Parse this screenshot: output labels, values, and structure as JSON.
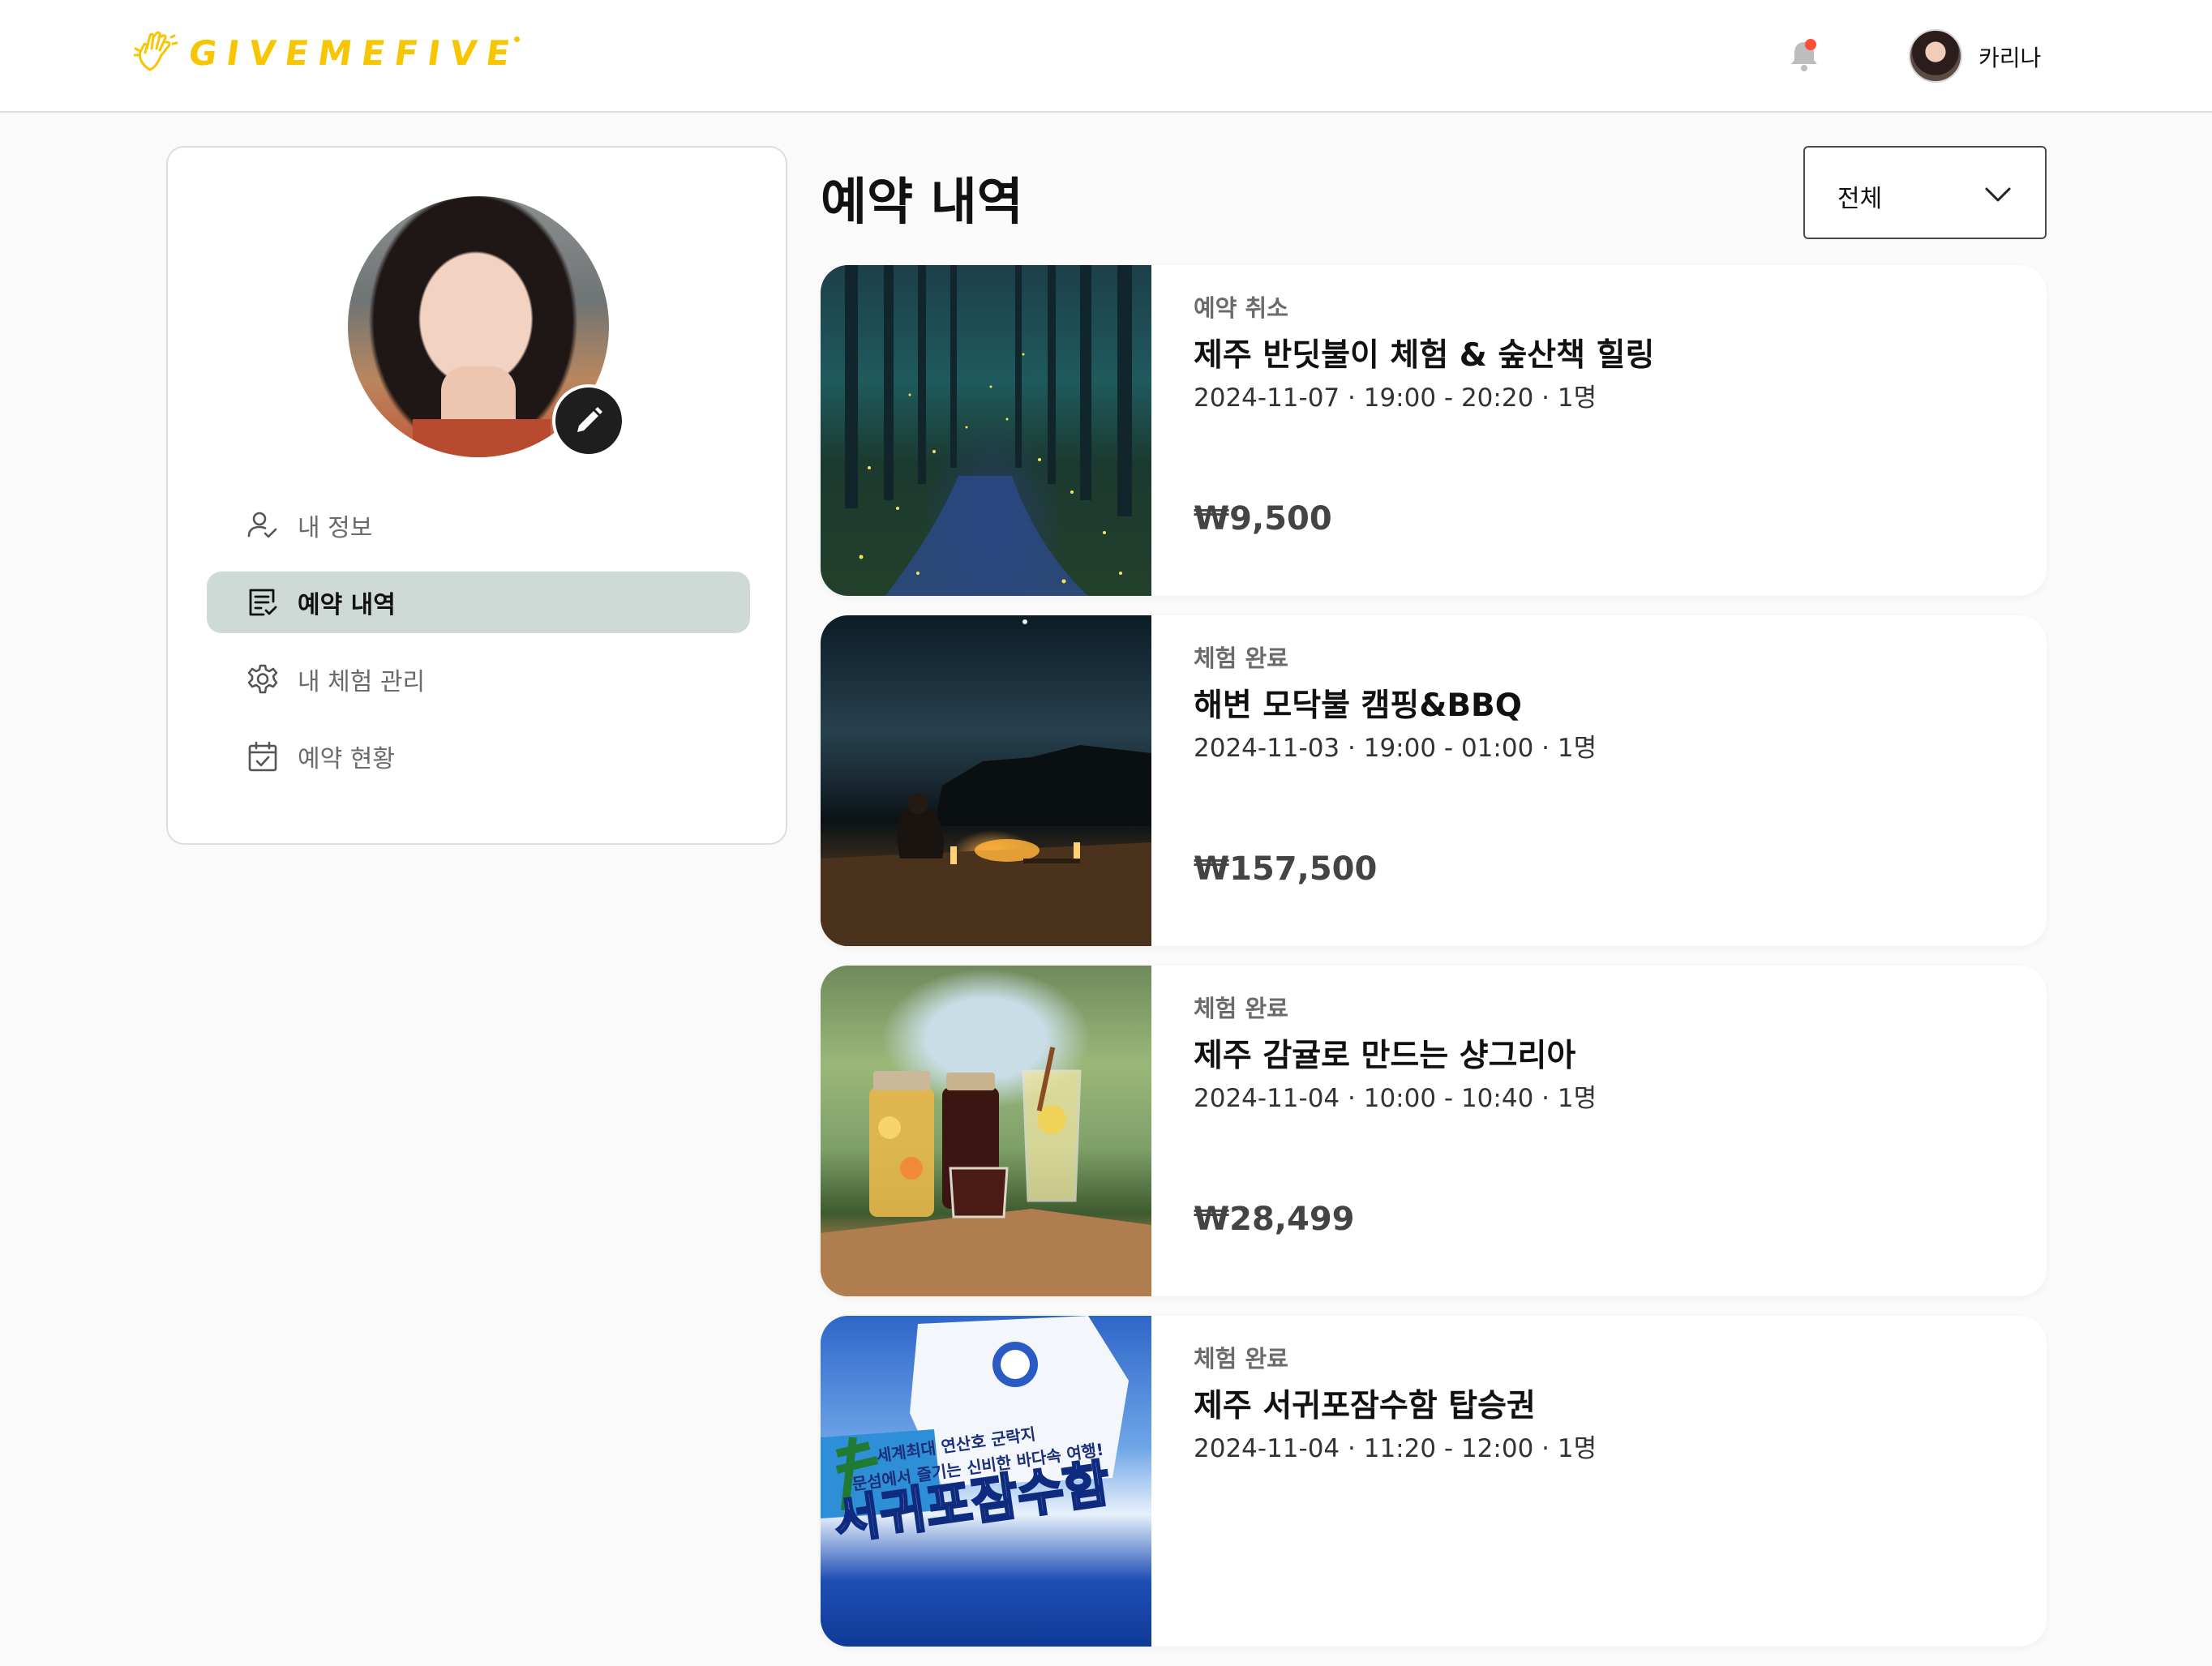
{
  "header": {
    "logo_text": "GIVEMEFIVE",
    "user_name": "카리나",
    "has_notification": true
  },
  "sidebar": {
    "items": [
      {
        "label": "내 정보",
        "icon": "user-check-icon",
        "active": false
      },
      {
        "label": "예약 내역",
        "icon": "list-check-icon",
        "active": true
      },
      {
        "label": "내 체험 관리",
        "icon": "gear-icon",
        "active": false
      },
      {
        "label": "예약 현황",
        "icon": "calendar-check-icon",
        "active": false
      }
    ]
  },
  "main": {
    "title": "예약 내역",
    "filter": {
      "selected": "전체"
    },
    "reservations": [
      {
        "status": "예약 취소",
        "title": "제주 반딧불이 체험 & 숲산책 힐링",
        "meta": "2024-11-07 · 19:00 - 20:20 · 1명",
        "price": "₩9,500"
      },
      {
        "status": "체험 완료",
        "title": "해변 모닥불 캠핑&BBQ",
        "meta": "2024-11-03 · 19:00 - 01:00 · 1명",
        "price": "₩157,500"
      },
      {
        "status": "체험 완료",
        "title": "제주 감귤로 만드는 샹그리아",
        "meta": "2024-11-04 · 10:00 - 10:40 · 1명",
        "price": "₩28,499"
      },
      {
        "status": "체험 완료",
        "title": "제주 서귀포잠수함 탑승권",
        "meta": "2024-11-04 · 11:20 - 12:00 · 1명",
        "price": "",
        "image_text_1": "세계최대 연산호 군락지",
        "image_text_2": "문섬에서 즐기는 신비한 바다속 여행!",
        "image_text_3": "서귀포잠수함"
      }
    ]
  },
  "colors": {
    "brand": "#f7c600",
    "active_menu_bg": "#cfd9d5",
    "notification_dot": "#ff4d3a"
  }
}
